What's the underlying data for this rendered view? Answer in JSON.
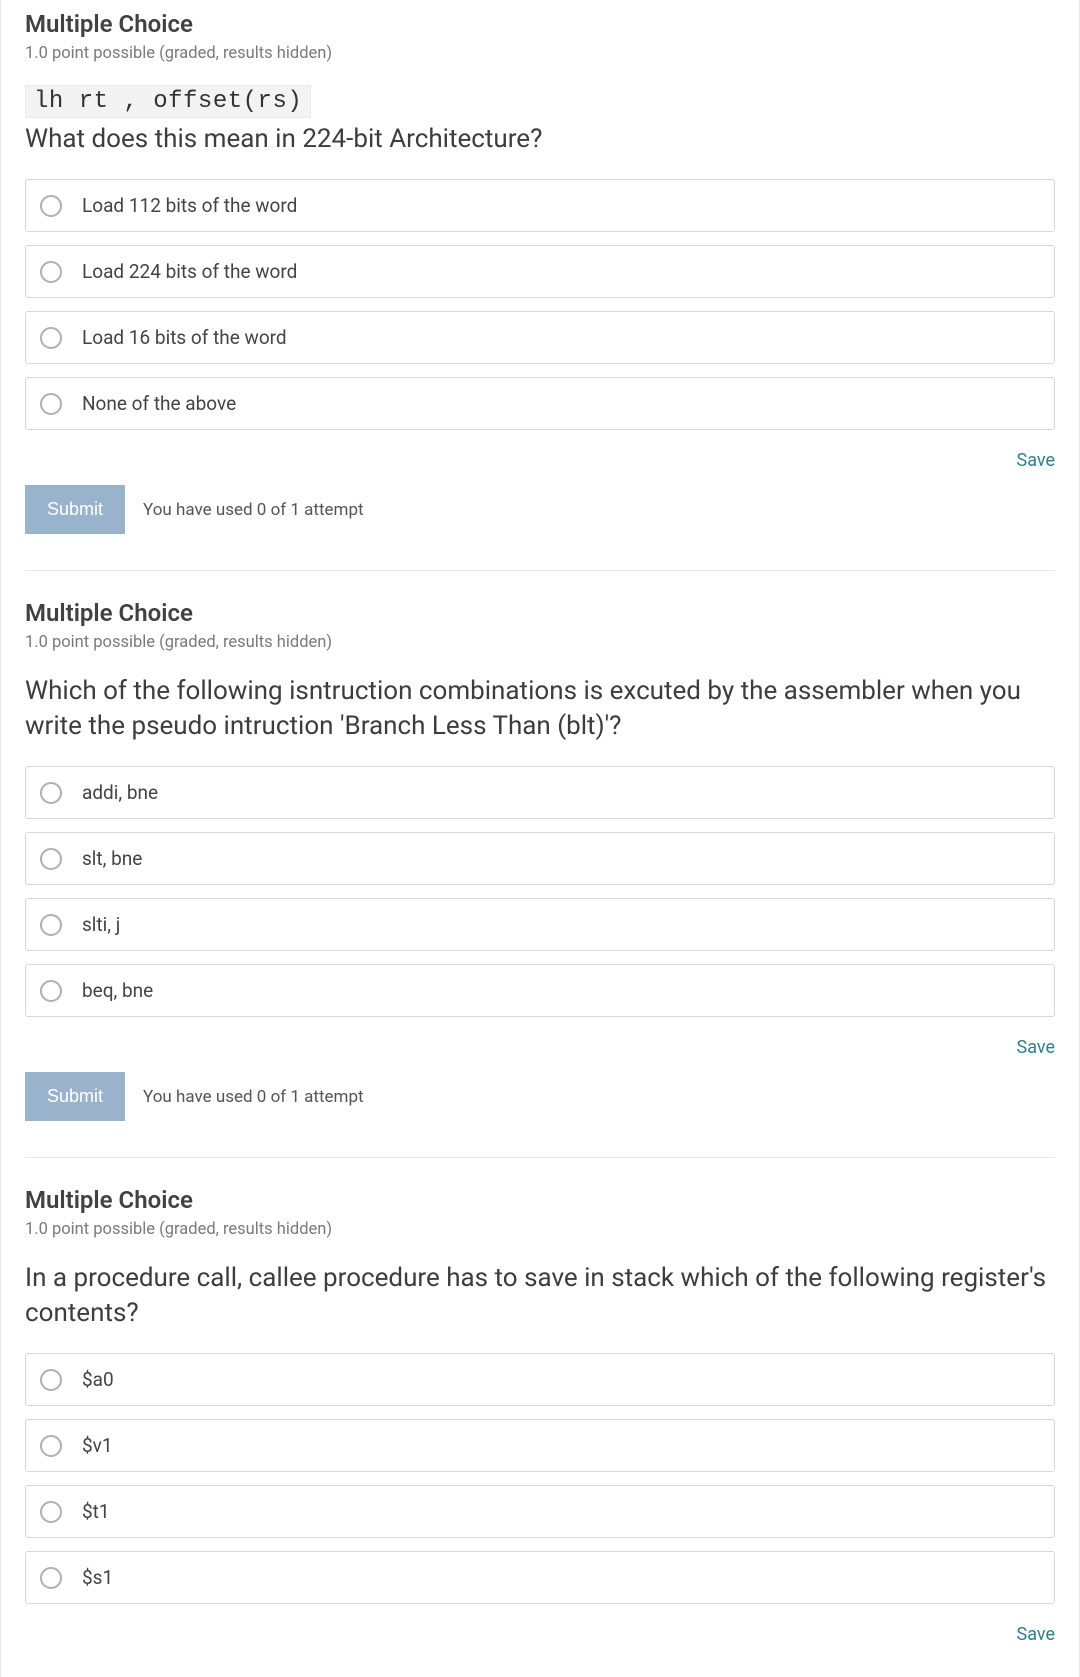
{
  "labels": {
    "save": "Save",
    "submit": "Submit"
  },
  "questions": [
    {
      "title": "Multiple Choice",
      "sub": "1.0 point possible (graded, results hidden)",
      "code": "lh rt , offset(rs)",
      "text": "What does this mean in 224-bit Architecture?",
      "options": [
        "Load 112 bits of the word",
        "Load 224 bits of the word",
        "Load 16 bits of the word",
        "None of the above"
      ],
      "attempt": "You have used 0 of 1 attempt"
    },
    {
      "title": "Multiple Choice",
      "sub": "1.0 point possible (graded, results hidden)",
      "code": "",
      "text": "Which of the following isntruction combinations is excuted by the assembler when you write the pseudo intruction 'Branch Less Than (blt)'?",
      "options": [
        "addi, bne",
        "slt, bne",
        "slti, j",
        "beq, bne"
      ],
      "attempt": "You have used 0 of 1 attempt"
    },
    {
      "title": "Multiple Choice",
      "sub": "1.0 point possible (graded, results hidden)",
      "code": "",
      "text": "In a procedure call, callee procedure has to save in stack which of the following register's contents?",
      "options": [
        "$a0",
        "$v1",
        "$t1",
        "$s1"
      ],
      "attempt": ""
    }
  ]
}
